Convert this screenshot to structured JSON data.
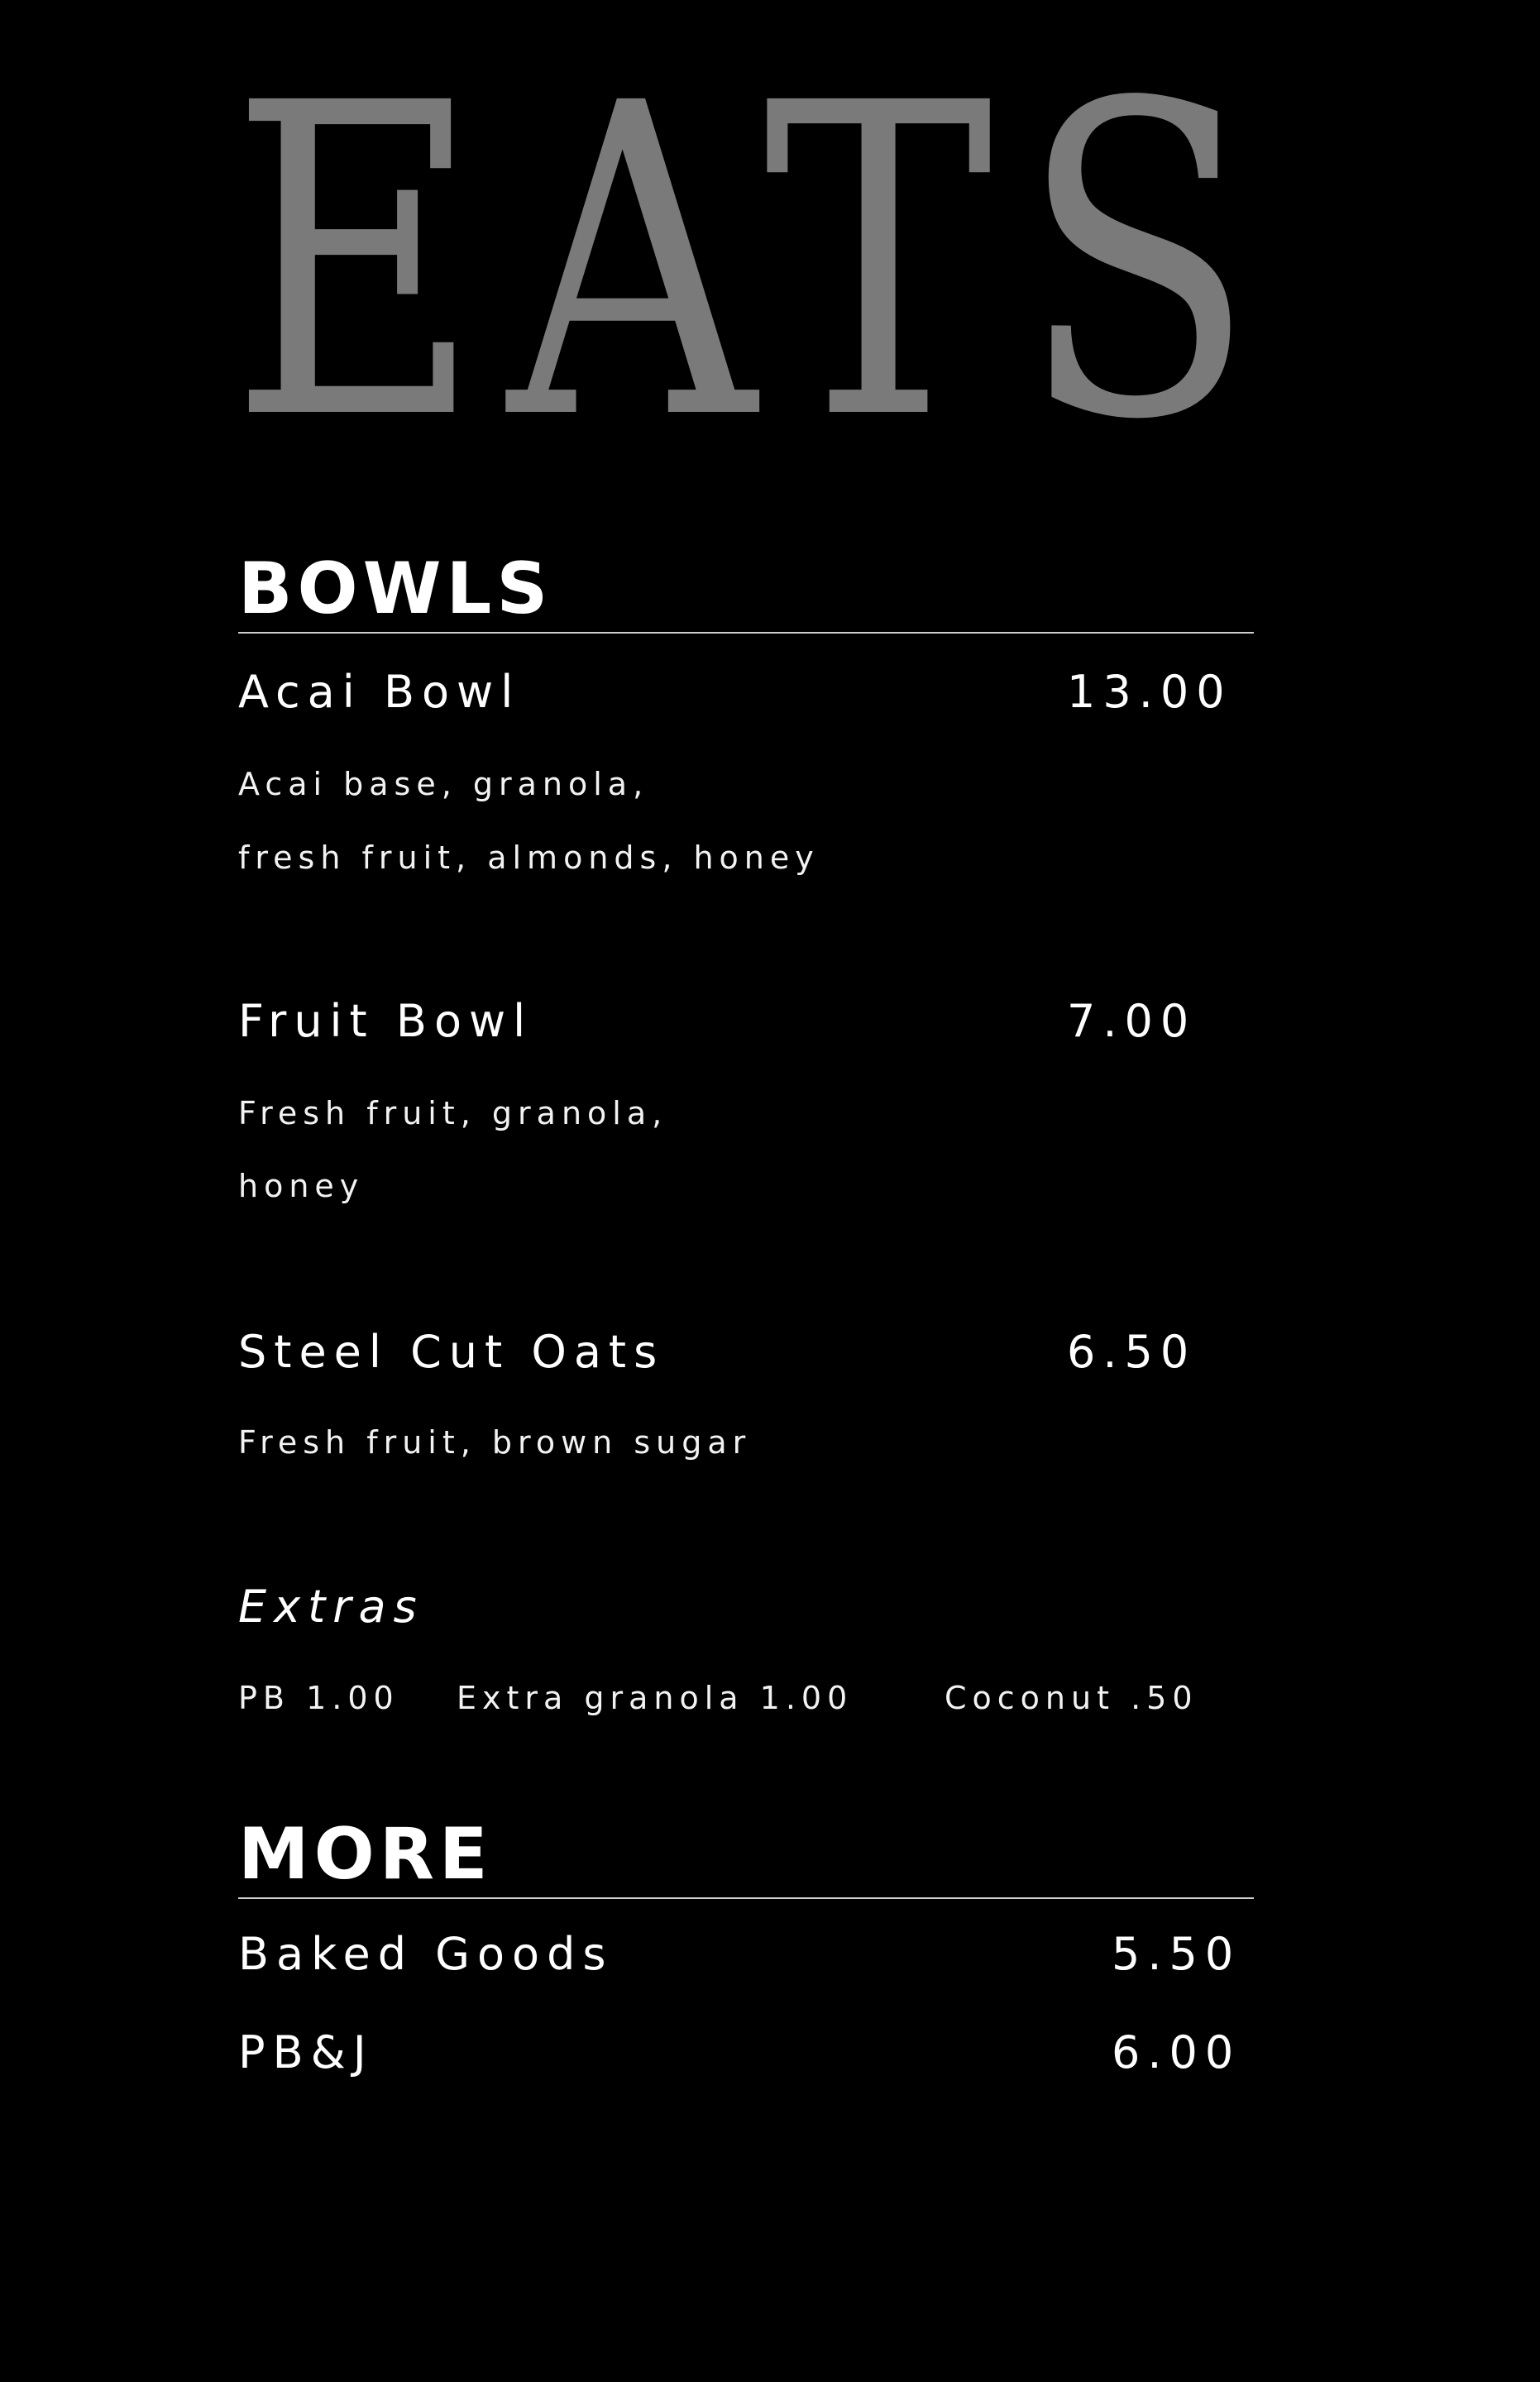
{
  "logo": {
    "text": "EATS",
    "color": "#7a7a7a"
  },
  "background_color": "#000000",
  "sections": {
    "bowls": {
      "heading": "BOWLS",
      "items": [
        {
          "name": "Acai Bowl",
          "price": "13.00",
          "desc": [
            "Acai base, granola,",
            "fresh fruit, almonds, honey"
          ]
        },
        {
          "name": "Fruit Bowl",
          "price": "7.00",
          "desc": [
            "Fresh fruit, granola,",
            "honey"
          ]
        },
        {
          "name": "Steel Cut Oats",
          "price": "6.50",
          "desc": [
            "Fresh fruit, brown sugar"
          ]
        }
      ],
      "extras": {
        "title": "Extras",
        "items": [
          "PB 1.00",
          "Extra granola 1.00",
          "Coconut .50"
        ]
      }
    },
    "more": {
      "heading": "MORE",
      "items": [
        {
          "name": "Baked Goods",
          "price": "5.50"
        },
        {
          "name": "PB&J",
          "price": "6.00"
        }
      ]
    }
  }
}
